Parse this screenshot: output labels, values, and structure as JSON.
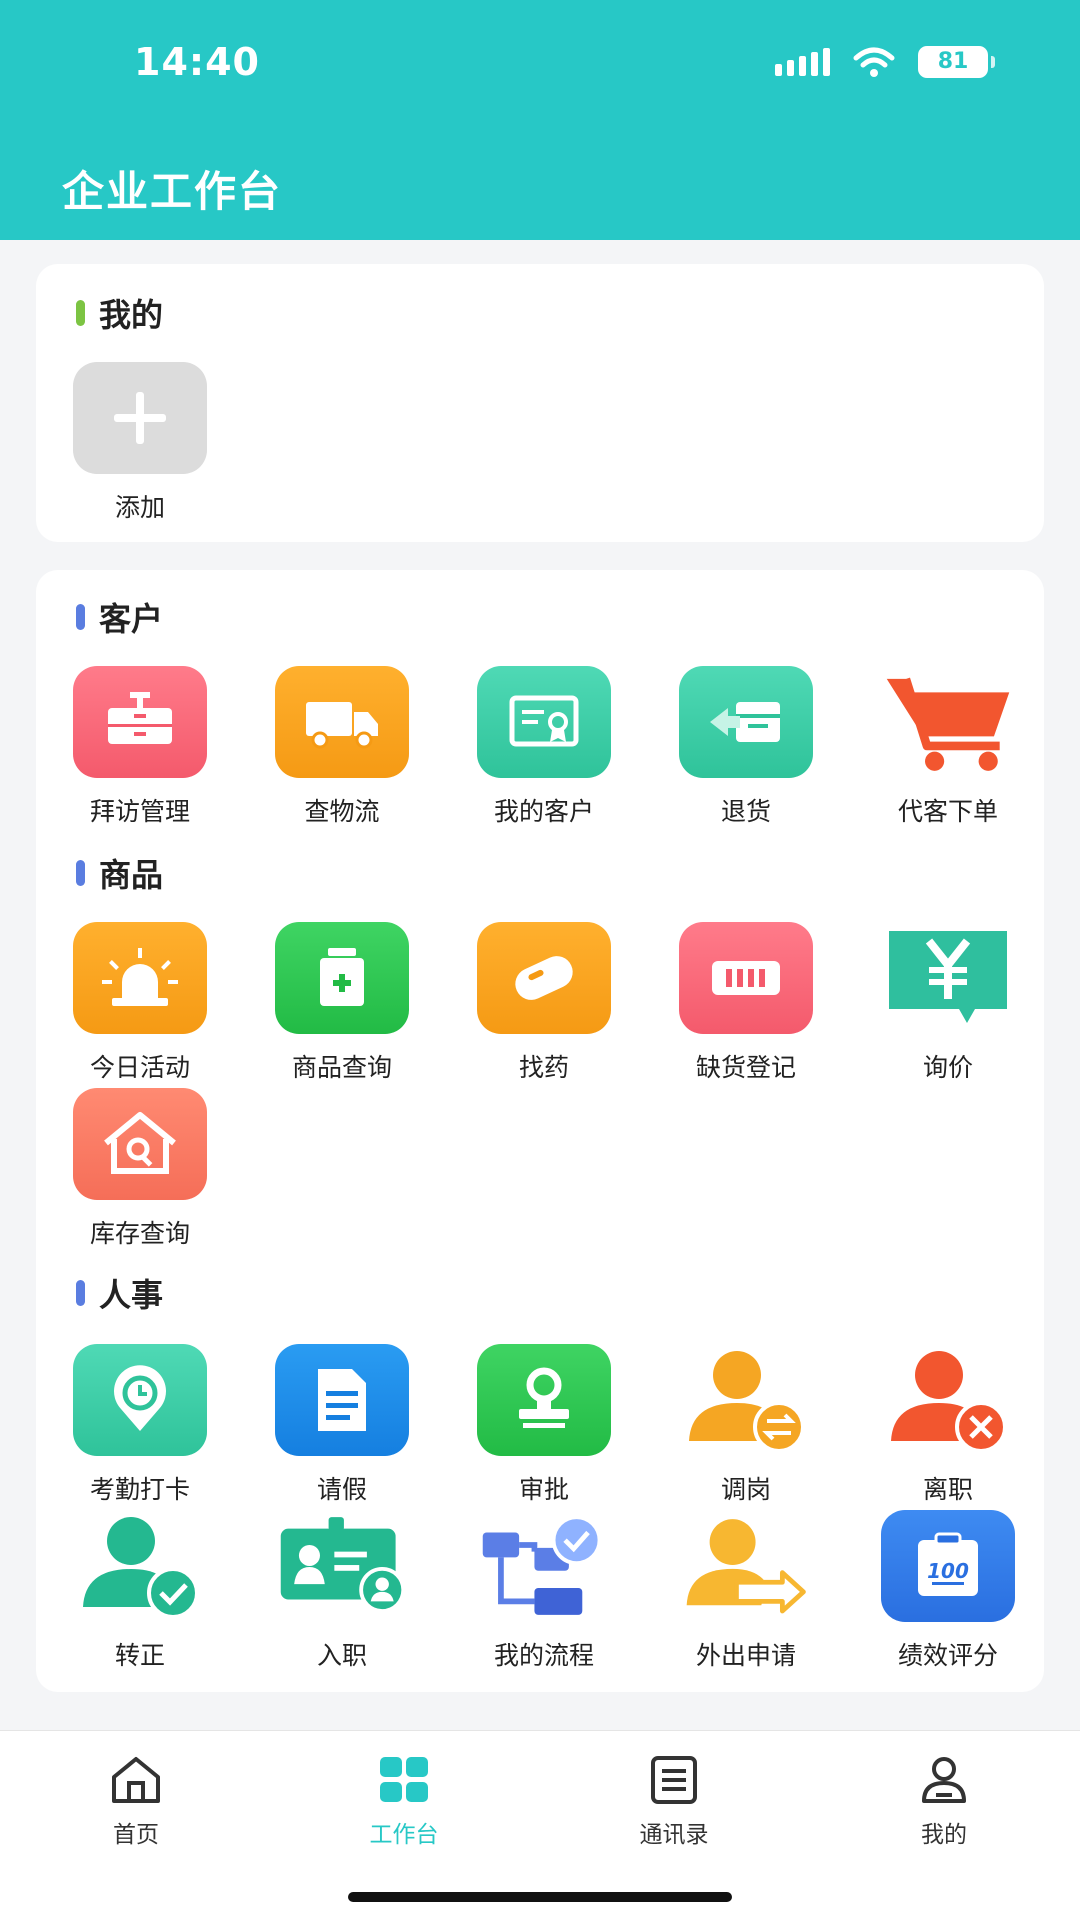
{
  "status": {
    "time": "14:40",
    "battery": "81"
  },
  "header": {
    "title": "企业工作台"
  },
  "mine": {
    "title": "我的",
    "add_label": "添加"
  },
  "sections": {
    "customer": {
      "title": "客户",
      "items": [
        "拜访管理",
        "查物流",
        "我的客户",
        "退货",
        "代客下单"
      ]
    },
    "goods": {
      "title": "商品",
      "items": [
        "今日活动",
        "商品查询",
        "找药",
        "缺货登记",
        "询价",
        "库存查询"
      ]
    },
    "hr": {
      "title": "人事",
      "items": [
        "考勤打卡",
        "请假",
        "审批",
        "调岗",
        "离职",
        "转正",
        "入职",
        "我的流程",
        "外出申请",
        "绩效评分"
      ]
    }
  },
  "tabbar": {
    "items": [
      "首页",
      "工作台",
      "通讯录",
      "我的"
    ],
    "active": "工作台"
  },
  "colors": {
    "brand": "#27c8c6",
    "section_bar_mine": "#7cc443",
    "section_bar": "#5a7de0"
  }
}
